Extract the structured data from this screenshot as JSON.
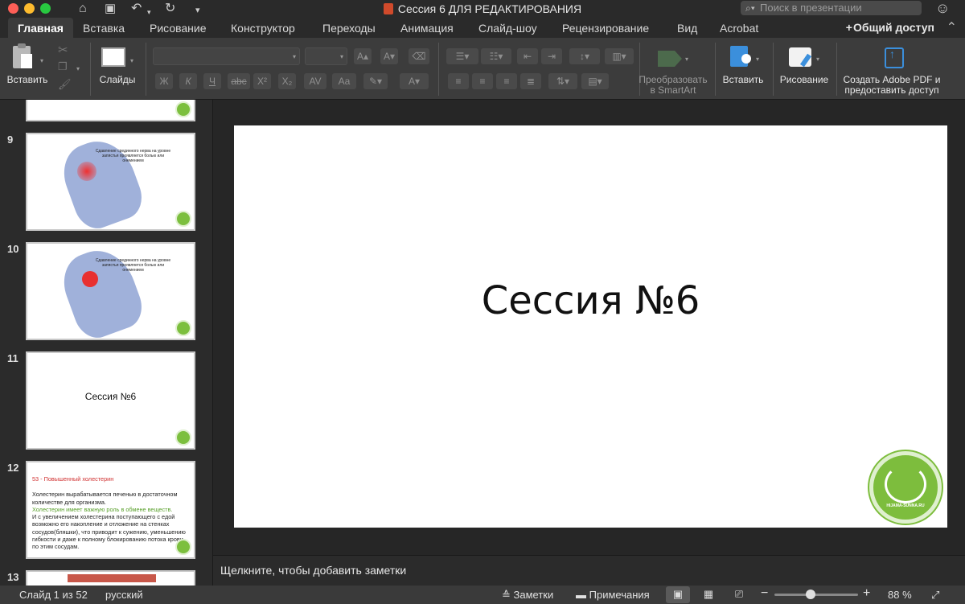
{
  "window": {
    "title": "Сессия 6 ДЛЯ РЕДАКТИРОВАНИЯ",
    "search_placeholder": "Поиск в презентации"
  },
  "quick_access": {
    "home_icon": "home-icon",
    "save_icon": "save-icon",
    "undo_icon": "undo-icon",
    "redo_icon": "redo-icon"
  },
  "tabs": [
    {
      "label": "Главная",
      "active": true
    },
    {
      "label": "Вставка"
    },
    {
      "label": "Рисование"
    },
    {
      "label": "Конструктор"
    },
    {
      "label": "Переходы"
    },
    {
      "label": "Анимация"
    },
    {
      "label": "Слайд-шоу"
    },
    {
      "label": "Рецензирование"
    },
    {
      "label": "Вид"
    },
    {
      "label": "Acrobat"
    }
  ],
  "share_label": "Общий доступ",
  "ribbon": {
    "paste_label": "Вставить",
    "slides_label": "Слайды",
    "font_buttons": [
      "Ж",
      "К",
      "Ч",
      "abc",
      "X²",
      "X₂",
      "AV",
      "Aa",
      "A"
    ],
    "smartart_label": "Преобразовать в SmartArt",
    "insert_label": "Вставить",
    "draw_label": "Рисование",
    "adobe_label": "Создать Adobe PDF и предоставить доступ"
  },
  "thumbnails": [
    {
      "num": "9",
      "caption": "Сдавление срединного нерва на уровне запястья проявляется болью или онемением"
    },
    {
      "num": "10",
      "caption": "Сдавление срединного нерва на уровне запястья проявляется болью или онемением"
    },
    {
      "num": "11",
      "title": "Сессия №6"
    },
    {
      "num": "12",
      "heading": "53 - Повышенный холестерин",
      "line1": "Холестерин вырабатывается печенью в достаточном количестве для организма.",
      "line2": "Холестерин имеет важную роль в обмене веществ.",
      "line3": "И с увеличением холестерина поступающего с едой возможно его накопление и отложение на стенках сосудов(бляшки), что приводит к сужению, уменьшению гибкости и даже к полному блокированию потока крови по этим сосудам."
    },
    {
      "num": "13"
    }
  ],
  "slide": {
    "title": "Сессия №6",
    "logo_text": "HIJAMA-SUNNA.RU"
  },
  "notes_placeholder": "Щелкните, чтобы добавить заметки",
  "status": {
    "slide_info": "Слайд 1 из 52",
    "language": "русский",
    "notes_label": "Заметки",
    "comments_label": "Примечания",
    "zoom": "88 %",
    "zoom_level": 0.88
  },
  "colors": {
    "accent_logo": "#7dbd3d",
    "heading_red": "#d03030",
    "text_green": "#5aa02c"
  }
}
